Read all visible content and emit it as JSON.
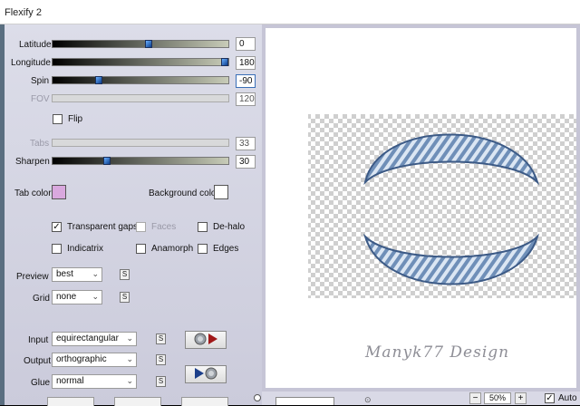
{
  "window": {
    "title": "Flexify 2"
  },
  "controls": {
    "latitude": {
      "label": "Latitude",
      "value": "0",
      "fraction": 0.55
    },
    "longitude": {
      "label": "Longitude",
      "value": "180",
      "fraction": 1.0
    },
    "spin": {
      "label": "Spin",
      "value": "-90",
      "fraction": 0.25
    },
    "fov": {
      "label": "FOV",
      "value": "120"
    },
    "flip": {
      "label": "Flip",
      "checked": false
    },
    "tabs": {
      "label": "Tabs",
      "value": "33"
    },
    "sharpen": {
      "label": "Sharpen",
      "value": "30",
      "fraction": 0.3
    }
  },
  "colors": {
    "tab_color_label": "Tab color",
    "tab_color": "#d9a8de",
    "background_color_label": "Background color",
    "background_color": "#ffffff"
  },
  "options": {
    "transparent_gaps": {
      "label": "Transparent gaps",
      "checked": true,
      "mark": "✓"
    },
    "faces": {
      "label": "Faces",
      "checked": false
    },
    "de_halo": {
      "label": "De-halo",
      "checked": false
    },
    "indicatrix": {
      "label": "Indicatrix",
      "checked": false
    },
    "anamorph": {
      "label": "Anamorph",
      "checked": false
    },
    "edges": {
      "label": "Edges",
      "checked": false
    }
  },
  "dropdowns": {
    "preview": {
      "label": "Preview",
      "value": "best"
    },
    "grid": {
      "label": "Grid",
      "value": "none"
    },
    "input": {
      "label": "Input",
      "value": "equirectangular"
    },
    "output": {
      "label": "Output",
      "value": "orthographic"
    },
    "glue": {
      "label": "Glue",
      "value": "normal"
    }
  },
  "small_button_text": "S",
  "preview_pane": {
    "watermark": "Manyk77 Design"
  },
  "statusbar": {
    "minus": "−",
    "zoom": "50%",
    "plus": "+",
    "auto_label": "Auto",
    "auto_checked": true,
    "auto_mark": "✓"
  }
}
